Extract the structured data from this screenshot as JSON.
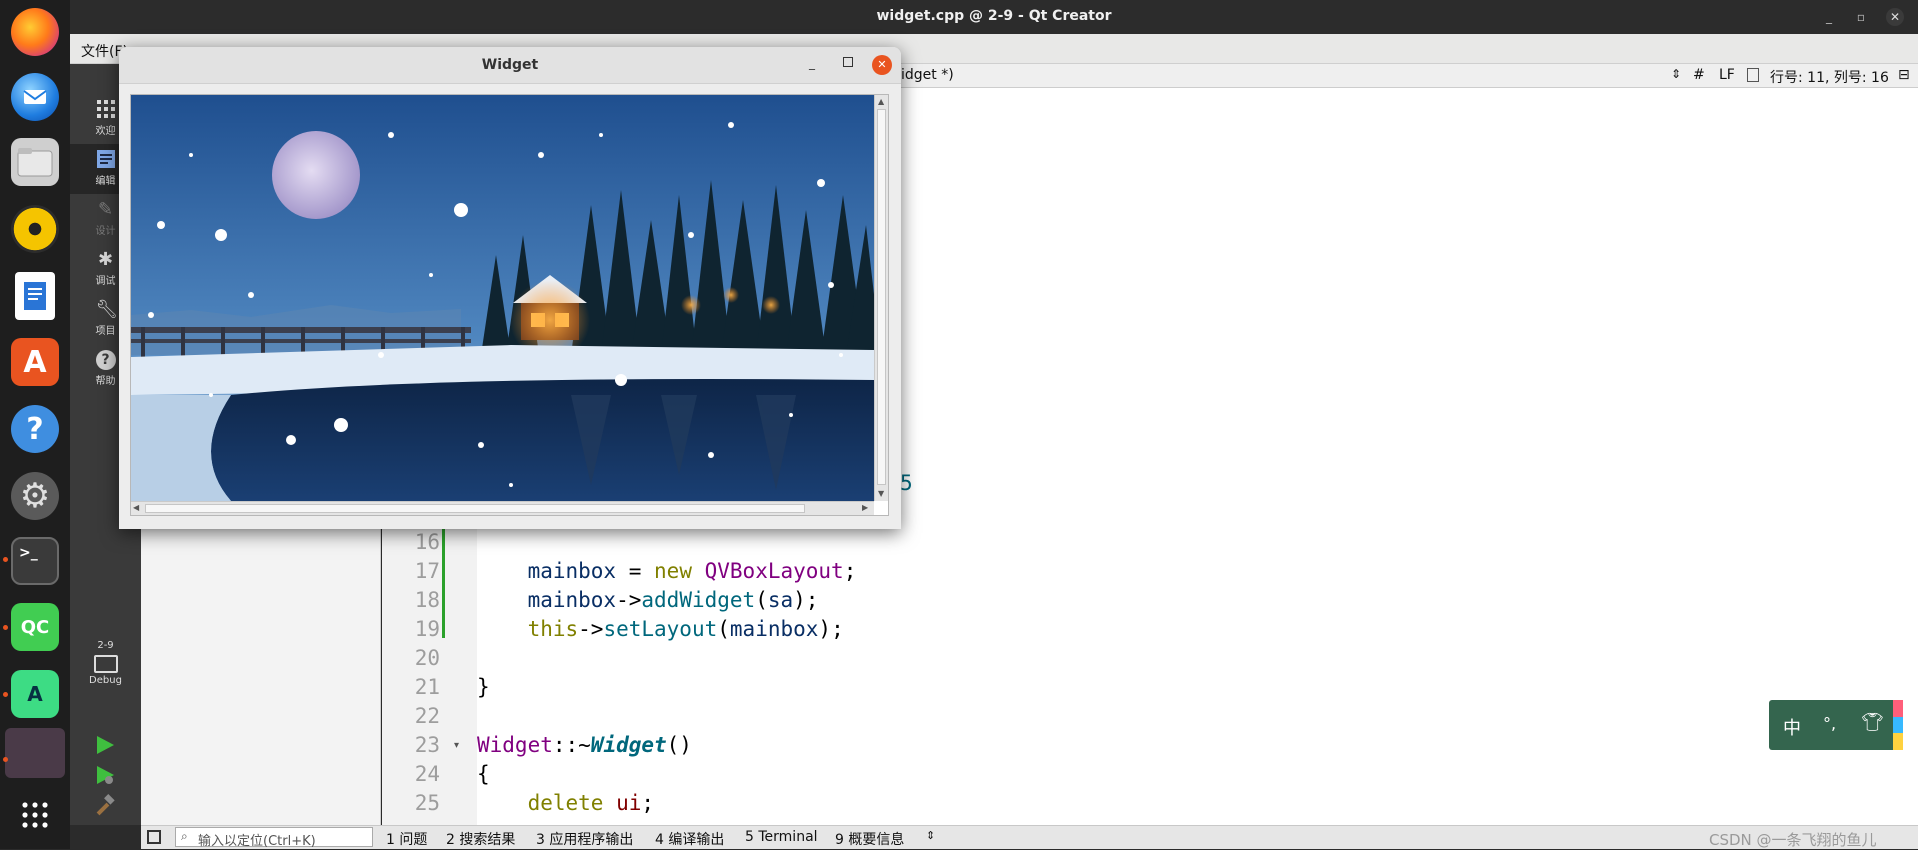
{
  "window": {
    "title": "widget.cpp @ 2-9 - Qt Creator"
  },
  "dock": {
    "apps": [
      {
        "name": "firefox-icon"
      },
      {
        "name": "thunderbird-icon"
      },
      {
        "name": "files-icon"
      },
      {
        "name": "rhythmbox-icon"
      },
      {
        "name": "libreoffice-writer-icon"
      },
      {
        "name": "software-center-icon"
      },
      {
        "name": "help-icon"
      },
      {
        "name": "settings-icon"
      },
      {
        "name": "terminal-icon"
      },
      {
        "name": "qt-creator-icon",
        "label": "QC"
      },
      {
        "name": "android-studio-icon",
        "label": "A"
      },
      {
        "name": "running-app-icon"
      }
    ]
  },
  "menubar": {
    "file": "文件(F)"
  },
  "modes": [
    {
      "label": "欢迎",
      "icon": "grid-icon"
    },
    {
      "label": "编辑",
      "icon": "edit-icon"
    },
    {
      "label": "设计",
      "icon": "design-icon"
    },
    {
      "label": "调试",
      "icon": "debug-icon"
    },
    {
      "label": "项目",
      "icon": "wrench-icon"
    },
    {
      "label": "帮助",
      "icon": "help-icon"
    }
  ],
  "kit": {
    "project": "2-9",
    "build": "Debug"
  },
  "toolbar": {
    "document": "idget *)",
    "hash": "#",
    "line_ending": "LF",
    "position": "行号: 11, 列号: 16"
  },
  "editor": {
    "lines": [
      {
        "n": "16"
      },
      {
        "n": "17",
        "code": "mainbox = new QVBoxLayout;"
      },
      {
        "n": "18",
        "code": "mainbox->addWidget(sa);"
      },
      {
        "n": "19",
        "code": "this->setLayout(mainbox);"
      },
      {
        "n": "20"
      },
      {
        "n": "21",
        "code": "}"
      },
      {
        "n": "22"
      },
      {
        "n": "23",
        "code": "Widget::~Widget()"
      },
      {
        "n": "24",
        "code": "{"
      },
      {
        "n": "25",
        "code": "delete ui;"
      }
    ],
    "fragment_5": "5"
  },
  "statusbar": {
    "locator_placeholder": "输入以定位(Ctrl+K)",
    "tabs": [
      {
        "n": "1",
        "label": "问题"
      },
      {
        "n": "2",
        "label": "搜索结果"
      },
      {
        "n": "3",
        "label": "应用程序输出"
      },
      {
        "n": "4",
        "label": "编译输出"
      },
      {
        "n": "5",
        "label": "Terminal"
      },
      {
        "n": "9",
        "label": "概要信息"
      }
    ]
  },
  "widget_window": {
    "title": "Widget"
  },
  "ime": {
    "lang": "中",
    "punct": "°,",
    "skin": "skin-icon"
  },
  "watermark": "CSDN @一条飞翔的鱼儿"
}
